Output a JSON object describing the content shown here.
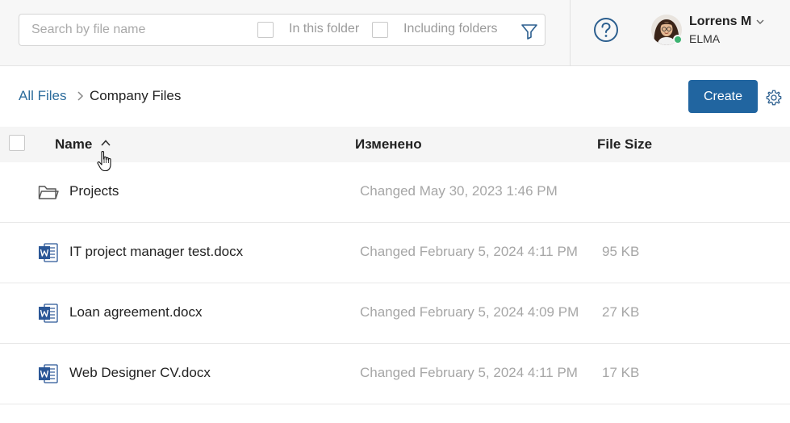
{
  "search": {
    "placeholder": "Search by file name",
    "value": "",
    "in_folder_label": "In this folder",
    "including_folders_label": "Including folders"
  },
  "icons": {
    "filter": "filter-icon",
    "help": "help-icon",
    "settings": "gear-icon",
    "folder": "folder-icon",
    "word": "word-document-icon"
  },
  "user": {
    "name": "Lorrens M",
    "org": "ELMA",
    "status_color": "#3cb371"
  },
  "breadcrumb": {
    "root": "All Files",
    "current": "Company Files"
  },
  "toolbar": {
    "create_label": "Create",
    "accent_color": "#2165a0"
  },
  "table": {
    "columns": {
      "name": "Name",
      "modified": "Изменено",
      "size": "File Size"
    },
    "rows": [
      {
        "type": "folder",
        "name": "Projects",
        "modified": "Changed May 30, 2023 1:46 PM",
        "size": ""
      },
      {
        "type": "word",
        "name": "IT project manager test.docx",
        "modified": "Changed February 5, 2024 4:11 PM",
        "size": "95 KB"
      },
      {
        "type": "word",
        "name": "Loan agreement.docx",
        "modified": "Changed February 5, 2024 4:09 PM",
        "size": "27 KB"
      },
      {
        "type": "word",
        "name": "Web Designer CV.docx",
        "modified": "Changed February 5, 2024 4:11 PM",
        "size": "17 KB"
      }
    ]
  }
}
